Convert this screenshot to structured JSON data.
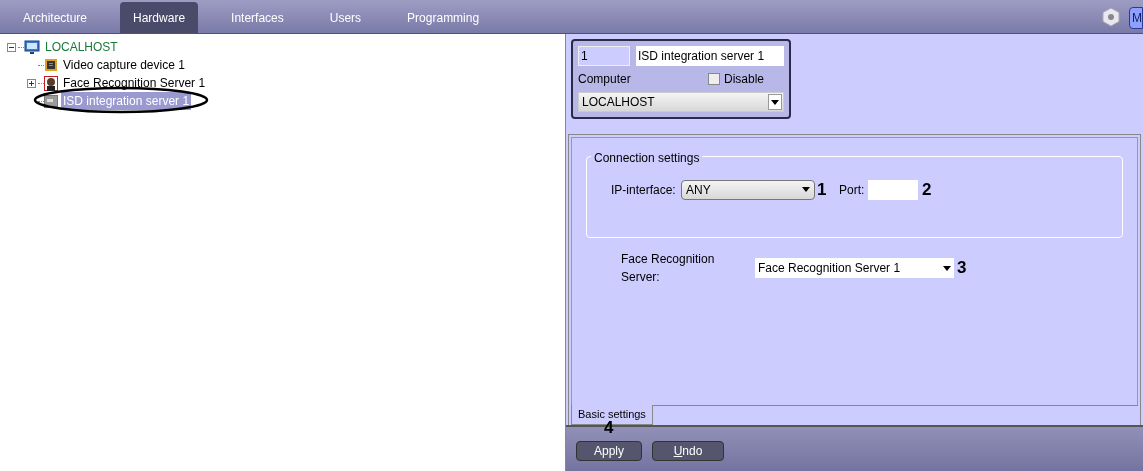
{
  "tabs": [
    {
      "label": "Architecture",
      "selected": false
    },
    {
      "label": "Hardware",
      "selected": true
    },
    {
      "label": "Interfaces",
      "selected": false
    },
    {
      "label": "Users",
      "selected": false
    },
    {
      "label": "Programming",
      "selected": false
    }
  ],
  "corner_button": {
    "label": "M"
  },
  "tree": [
    {
      "label": "LOCALHOST",
      "kind": "computer",
      "expanded": true,
      "selected": false,
      "children": [
        {
          "label": "Video capture device 1",
          "kind": "chip",
          "selected": false
        },
        {
          "label": "Face Recognition Server 1",
          "kind": "face",
          "expanded": false,
          "selected": false
        },
        {
          "label": "ISD integration server 1",
          "kind": "server",
          "selected": true
        }
      ]
    }
  ],
  "object": {
    "id": "1",
    "name": "ISD integration server 1",
    "computer_label": "Computer",
    "disable": {
      "label": "Disable",
      "checked": false
    },
    "computer": "LOCALHOST"
  },
  "connection": {
    "title": "Connection settings",
    "ip_label": "IP-interface:",
    "ip": "ANY",
    "ip_marker": "1",
    "port_label": "Port:",
    "port_marker": "2"
  },
  "face_server": {
    "label": "Face Recognition Server:",
    "value": "Face Recognition Server 1",
    "marker": "3"
  },
  "settings_tabs": [
    {
      "label": "Basic settings",
      "selected": true
    }
  ],
  "apply_marker": "4",
  "buttons": [
    "Apply",
    "Undo"
  ]
}
